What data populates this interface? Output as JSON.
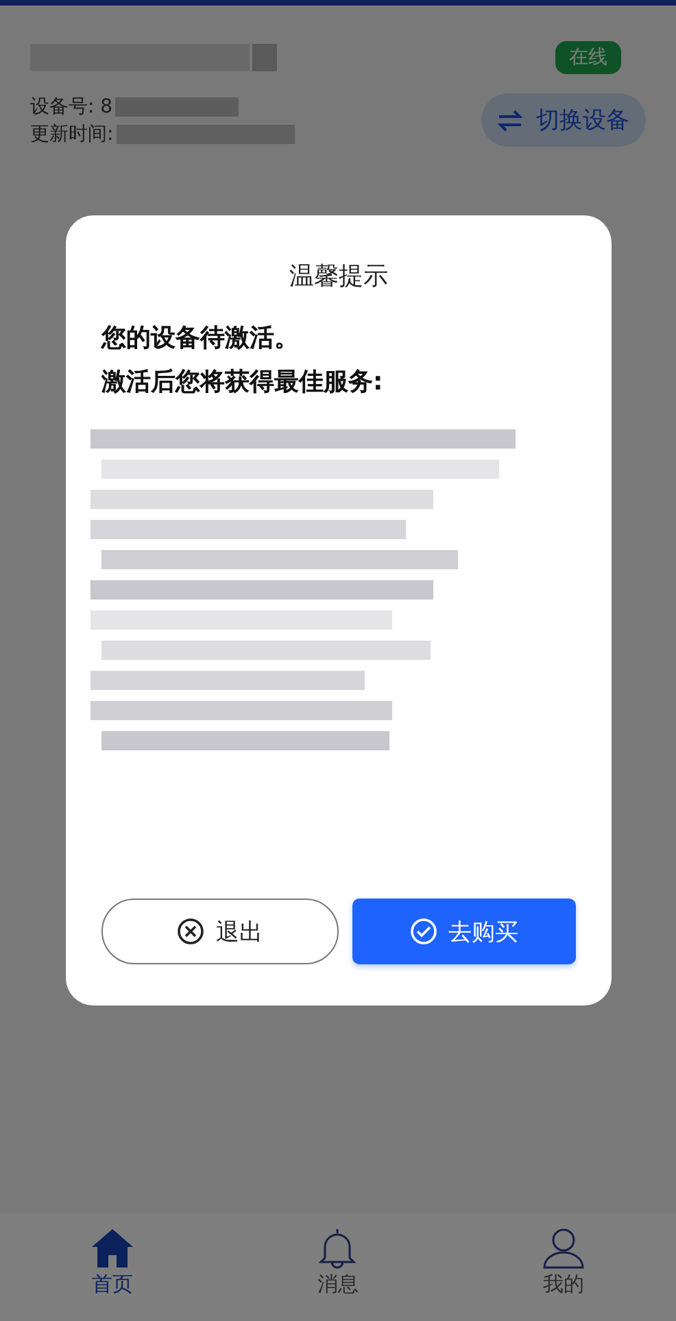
{
  "device": {
    "status": "在线",
    "id_label": "设备号: 8",
    "updated_label": "更新时间:",
    "switch_button": "切换设备"
  },
  "dialog": {
    "title": "温馨提示",
    "lines": [
      "您的设备待激活。",
      "激活后您将获得最佳服务:"
    ],
    "buttons": [
      {
        "kind": "outline",
        "label": "退出"
      },
      {
        "kind": "primary",
        "label": "去购买"
      }
    ]
  },
  "tabs": [
    {
      "label": "首页",
      "selected": true
    },
    {
      "label": "消息",
      "selected": false
    },
    {
      "label": "我的",
      "selected": false
    }
  ]
}
